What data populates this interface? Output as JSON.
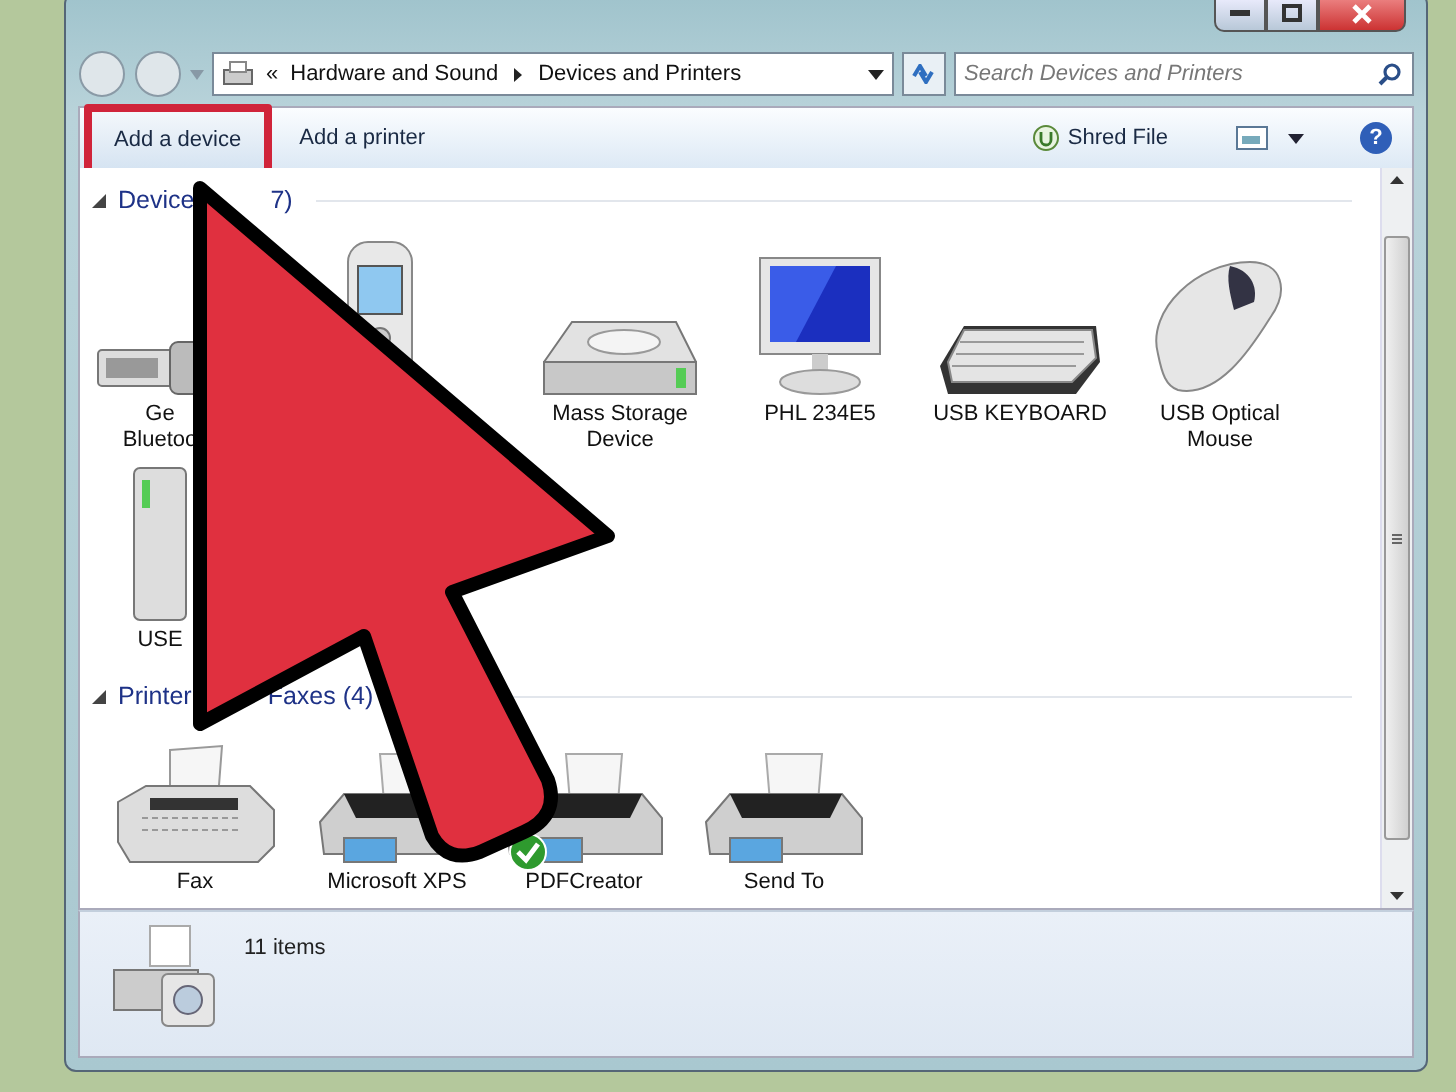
{
  "address": {
    "prefix": "«",
    "crumbs": [
      "Hardware and Sound",
      "Devices and Printers"
    ]
  },
  "search": {
    "placeholder": "Search Devices and Printers"
  },
  "toolbar": {
    "buttons": [
      {
        "label": "Add a device",
        "highlighted": true
      },
      {
        "label": "Add a printer",
        "highlighted": false
      }
    ],
    "shred": {
      "label": "Shred File"
    },
    "help": "?"
  },
  "sections": [
    {
      "title_parts": [
        "Device",
        "7)"
      ],
      "expanded": true,
      "items": [
        {
          "kind": "usb",
          "label": "Ge\nBluetoo",
          "default": false
        },
        {
          "kind": "phone",
          "default": false
        },
        {
          "kind": "drive",
          "label": "Mass Storage\nDevice",
          "default": false
        },
        {
          "kind": "monitor",
          "label": "PHL 234E5",
          "default": false
        },
        {
          "kind": "keyboard",
          "label": "USB KEYBOARD",
          "default": false
        },
        {
          "kind": "mouse",
          "label": "USB Optical\nMouse",
          "default": false
        },
        {
          "kind": "tower",
          "label": "USE",
          "default": false
        }
      ]
    },
    {
      "title_parts": [
        "Printer",
        "Faxes (4)"
      ],
      "expanded": true,
      "items": [
        {
          "kind": "fax",
          "label": "Fax",
          "default": false
        },
        {
          "kind": "printer",
          "label": "Microsoft XPS",
          "default": false
        },
        {
          "kind": "printer",
          "label": "PDFCreator",
          "default": true
        },
        {
          "kind": "printer",
          "label": "Send To",
          "default": false
        }
      ]
    }
  ],
  "status": {
    "count": "11 items"
  },
  "annotation": {
    "arrow": true
  }
}
